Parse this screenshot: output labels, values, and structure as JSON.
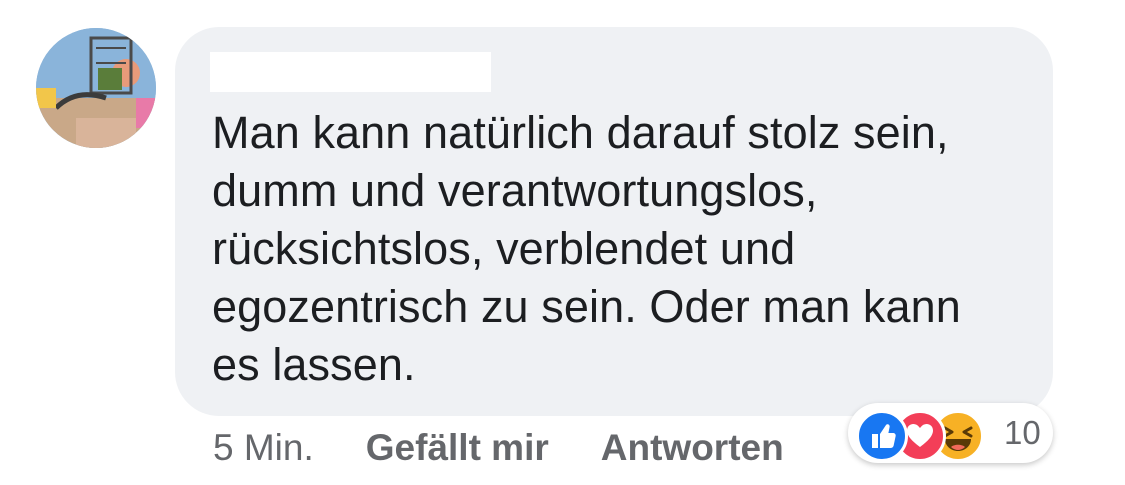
{
  "comment": {
    "text_lines": [
      "Man kann natürlich darauf stolz sein,",
      "dumm und verantwortungslos,",
      "rücksichtslos, verblendet und",
      "egozentrisch zu sein. Oder man kann",
      "es lassen."
    ]
  },
  "actions": {
    "time": "5 Min.",
    "like_label": "Gefällt mir",
    "reply_label": "Antworten"
  },
  "reactions": {
    "icons": [
      "like-icon",
      "love-icon",
      "haha-icon"
    ],
    "count": "10",
    "colors": {
      "like": "#1877f2",
      "love": "#f33e58",
      "haha": "#f7b125"
    }
  },
  "colors": {
    "bubble": "#eff1f4",
    "text": "#1c1e21",
    "secondary_text": "#65676b"
  }
}
